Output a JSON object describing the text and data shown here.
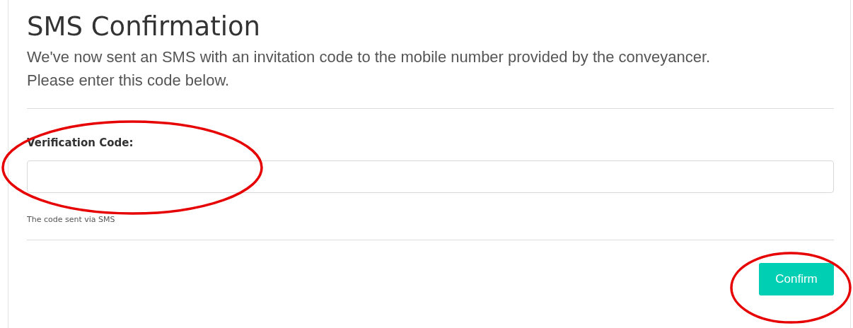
{
  "heading": "SMS Confirmation",
  "intro": "We've now sent an SMS with an invitation code to the mobile number provided by the conveyancer. Please enter this code below.",
  "field": {
    "label": "Verification Code:",
    "help": "The code sent via SMS"
  },
  "button": {
    "label": "Confirm"
  }
}
